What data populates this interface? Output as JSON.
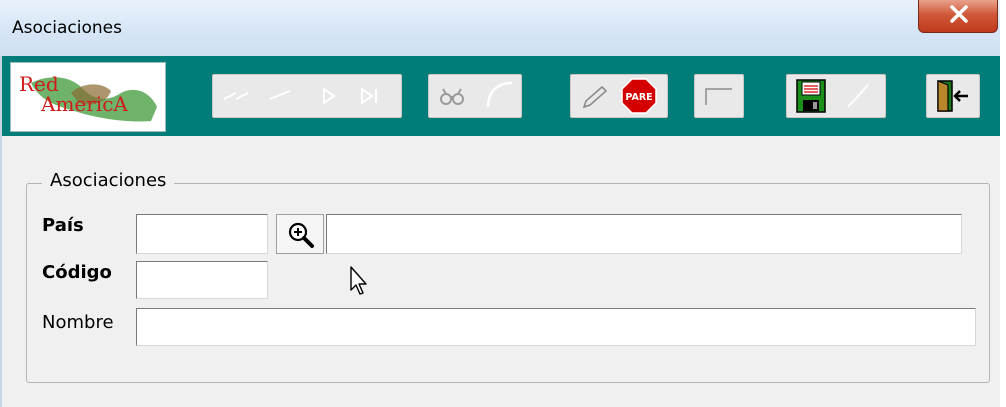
{
  "window": {
    "title": "Asociaciones",
    "close_label": "X"
  },
  "toolbar": {
    "logo": {
      "line1": "Red",
      "line2": "AmericA"
    },
    "stop_label": "PARE",
    "colors": {
      "background": "#007d78",
      "stop": "#d40000",
      "save": "#1a8f1a"
    }
  },
  "form": {
    "group_title": "Asociaciones",
    "pais": {
      "label": "País",
      "code_value": "",
      "name_value": ""
    },
    "codigo": {
      "label": "Código",
      "value": ""
    },
    "nombre": {
      "label": "Nombre",
      "value": ""
    }
  }
}
